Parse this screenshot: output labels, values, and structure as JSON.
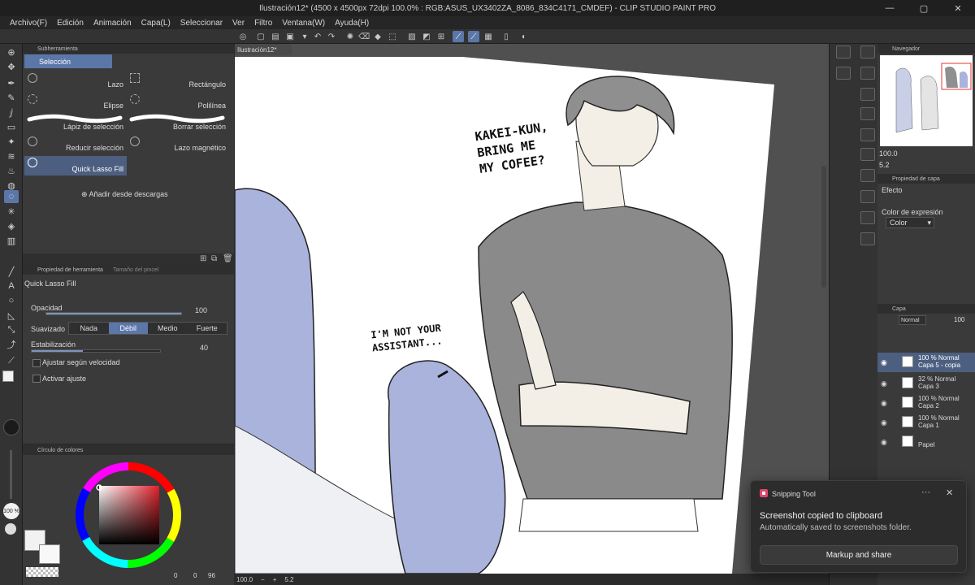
{
  "window": {
    "title": "Ilustración12* (4500 x 4500px 72dpi 100.0% : RGB:ASUS_UX3402ZA_8086_834C4171_CMDEF) - CLIP STUDIO PAINT PRO",
    "controls": [
      "—",
      "▢",
      "✕"
    ]
  },
  "menu": [
    "Archivo(F)",
    "Edición",
    "Animación",
    "Capa(L)",
    "Seleccionar",
    "Ver",
    "Filtro",
    "Ventana(W)",
    "Ayuda(H)"
  ],
  "subtool": {
    "header": "Subherramienta",
    "group": "Selección",
    "items": [
      {
        "label": "Lazo"
      },
      {
        "label": "Rectángulo"
      },
      {
        "label": "Elipse"
      },
      {
        "label": "Polilínea"
      },
      {
        "label": "Lápiz de selección"
      },
      {
        "label": "Borrar selección"
      },
      {
        "label": "Reducir selección"
      },
      {
        "label": "Lazo magnético"
      },
      {
        "label": "Quick Lasso Fill"
      }
    ],
    "add_label": "Añadir desde descargas"
  },
  "toolprop": {
    "tabs": [
      "Propiedad de herramienta",
      "Tamaño del pincel"
    ],
    "tool_name": "Quick Lasso Fill",
    "opacity_label": "Opacidad",
    "opacity_value": "100",
    "smoothing_label": "Suavizado",
    "smoothing_options": [
      "Nada",
      "Débil",
      "Medio",
      "Fuerte"
    ],
    "smoothing_selected": "Débil",
    "stabilization_label": "Estabilización",
    "stabilization_value": "40",
    "speed_label": "Ajustar según velocidad",
    "adjust_label": "Activar ajuste"
  },
  "colorpanel": {
    "tab": "Círculo de colores",
    "opacity_badge": "100 %",
    "readout": [
      "0",
      "0",
      "96"
    ]
  },
  "canvas": {
    "doc_tab": "Ilustración12*",
    "speech_1": [
      "KAKEI-KUN,",
      "BRING ME",
      "MY COFEE?"
    ],
    "speech_2": [
      "I'M NOT YOUR",
      "ASSISTANT..."
    ]
  },
  "statusbar": {
    "zoom": "100.0",
    "rotation": "5.2"
  },
  "navigator": {
    "tab": "Navegador",
    "zoom": "100.0",
    "rotation": "5.2"
  },
  "properties": {
    "tab": "Propiedad de capa",
    "effect_label": "Efecto",
    "expression_label": "Color de expresión",
    "expression_value": "Color"
  },
  "layers": {
    "tab": "Capa",
    "blend": "Normal",
    "opacity": "100",
    "items": [
      {
        "line1": "100 % Normal",
        "line2": "Capa 5 - copia",
        "selected": true
      },
      {
        "line1": "32 % Normal",
        "line2": "Capa 3",
        "selected": false
      },
      {
        "line1": "100 % Normal",
        "line2": "Capa 2",
        "selected": false
      },
      {
        "line1": "100 % Normal",
        "line2": "Capa 1",
        "selected": false
      },
      {
        "line1": "",
        "line2": "Papel",
        "selected": false
      }
    ]
  },
  "toast": {
    "app": "Snipping Tool",
    "title": "Screenshot copied to clipboard",
    "detail": "Automatically saved to screenshots folder.",
    "button": "Markup and share"
  },
  "colors": {
    "accent": "#5b77a8",
    "selection": "#4d5f80",
    "hair": "#a9b3dc",
    "shirt": "#8a8a8a"
  }
}
